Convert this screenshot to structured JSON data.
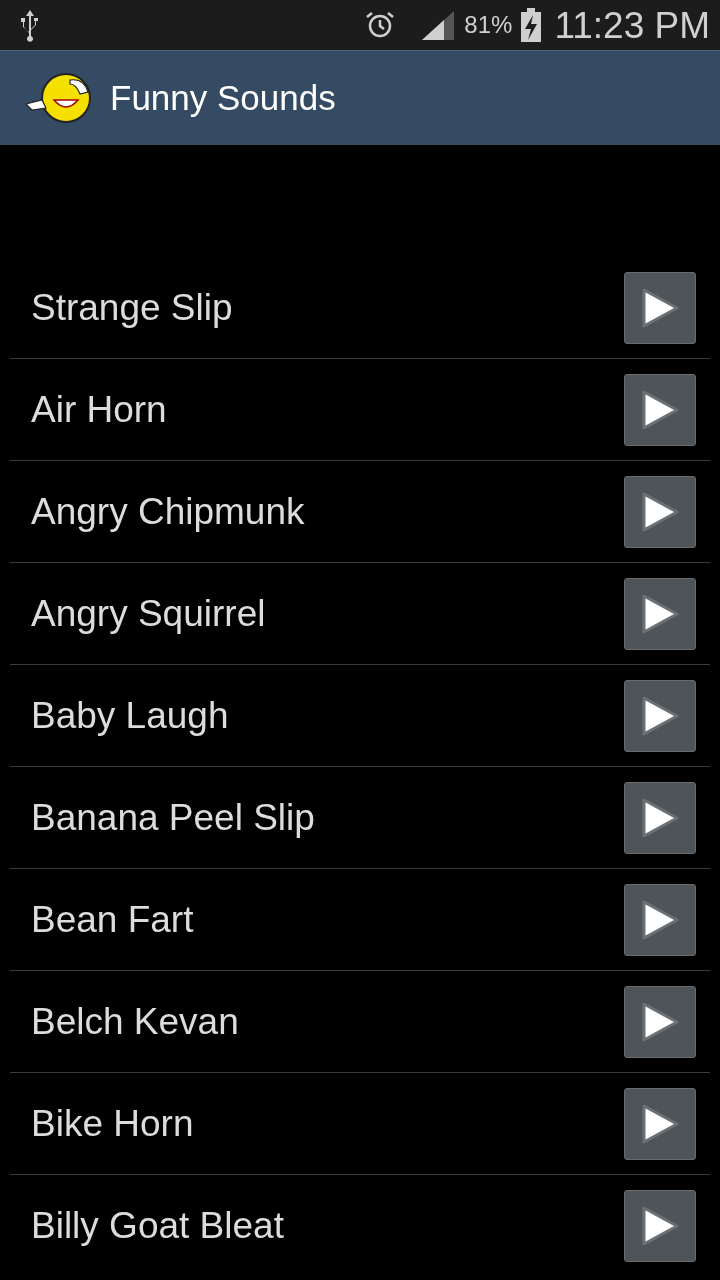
{
  "status_bar": {
    "battery": "81%",
    "time": "11:23 PM"
  },
  "app_bar": {
    "title": "Funny Sounds"
  },
  "sounds": [
    {
      "name": "Strange Slip"
    },
    {
      "name": "Air Horn"
    },
    {
      "name": "Angry Chipmunk"
    },
    {
      "name": "Angry Squirrel"
    },
    {
      "name": "Baby Laugh"
    },
    {
      "name": "Banana Peel Slip"
    },
    {
      "name": "Bean Fart"
    },
    {
      "name": "Belch Kevan"
    },
    {
      "name": "Bike Horn"
    },
    {
      "name": "Billy Goat Bleat"
    }
  ]
}
